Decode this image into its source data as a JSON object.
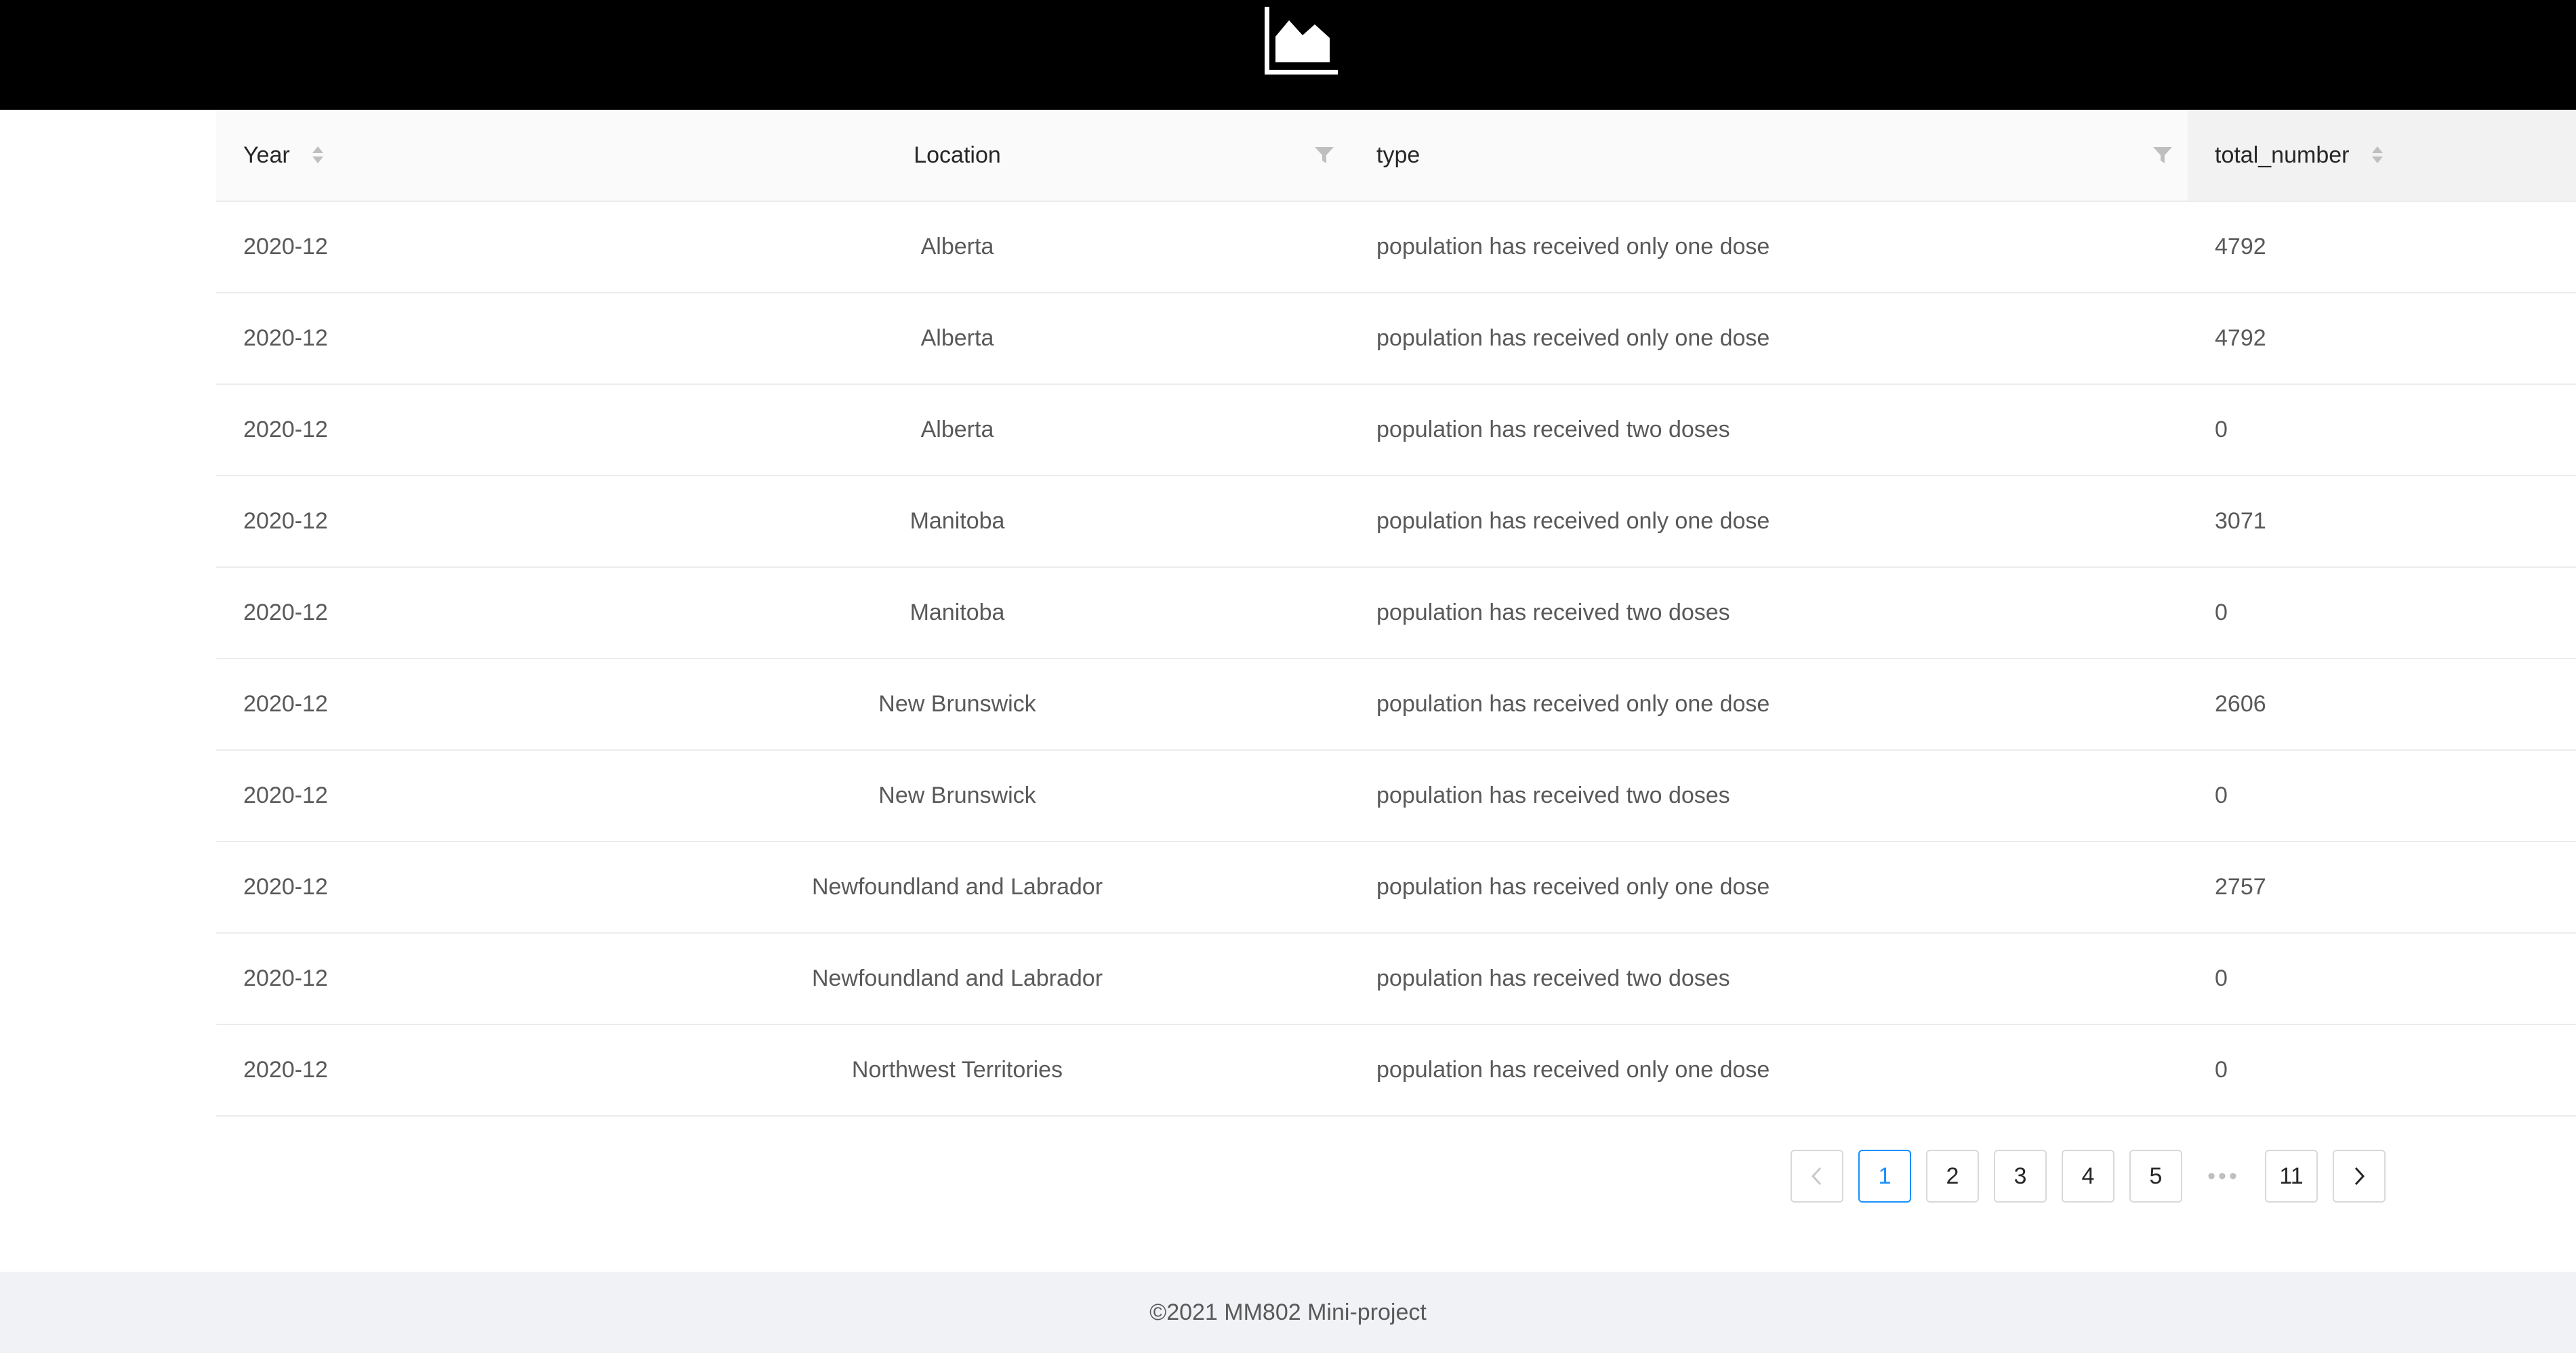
{
  "header": {
    "logo_icon": "area-chart-icon"
  },
  "table": {
    "columns": [
      {
        "label": "Year",
        "sortable": true,
        "filterable": false
      },
      {
        "label": "Location",
        "sortable": false,
        "filterable": true
      },
      {
        "label": "type",
        "sortable": false,
        "filterable": true
      },
      {
        "label": "total_number",
        "sortable": true,
        "filterable": false
      }
    ],
    "rows": [
      {
        "year": "2020-12",
        "location": "Alberta",
        "type": "population has received only one dose",
        "total": "4792"
      },
      {
        "year": "2020-12",
        "location": "Alberta",
        "type": "population has received only one dose",
        "total": "4792"
      },
      {
        "year": "2020-12",
        "location": "Alberta",
        "type": "population has received two doses",
        "total": "0"
      },
      {
        "year": "2020-12",
        "location": "Manitoba",
        "type": "population has received only one dose",
        "total": "3071"
      },
      {
        "year": "2020-12",
        "location": "Manitoba",
        "type": "population has received two doses",
        "total": "0"
      },
      {
        "year": "2020-12",
        "location": "New Brunswick",
        "type": "population has received only one dose",
        "total": "2606"
      },
      {
        "year": "2020-12",
        "location": "New Brunswick",
        "type": "population has received two doses",
        "total": "0"
      },
      {
        "year": "2020-12",
        "location": "Newfoundland and Labrador",
        "type": "population has received only one dose",
        "total": "2757"
      },
      {
        "year": "2020-12",
        "location": "Newfoundland and Labrador",
        "type": "population has received two doses",
        "total": "0"
      },
      {
        "year": "2020-12",
        "location": "Northwest Territories",
        "type": "population has received only one dose",
        "total": "0"
      }
    ]
  },
  "pagination": {
    "prev_icon": "chevron-left-icon",
    "next_icon": "chevron-right-icon",
    "pages": [
      "1",
      "2",
      "3",
      "4",
      "5"
    ],
    "ellipsis": "•••",
    "last_page": "11",
    "current": "1"
  },
  "footer": {
    "text": "©2021 MM802 Mini-project"
  },
  "colors": {
    "header_bg": "#000000",
    "accent": "#1890ff",
    "footer_bg": "#f0f2f5"
  }
}
